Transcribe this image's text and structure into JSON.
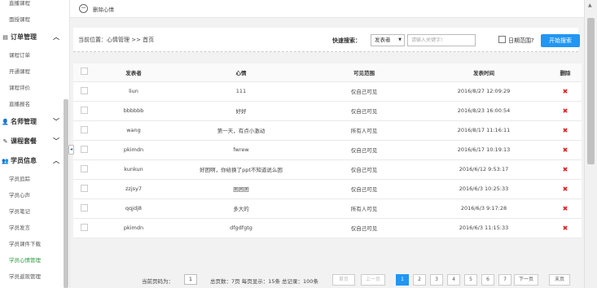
{
  "sidebar": {
    "items_top": [
      "直播课程",
      "面授课程"
    ],
    "order_group": {
      "label": "订单管理",
      "items": [
        "课程订单",
        "开通课程",
        "课程评价",
        "直播报名"
      ]
    },
    "teacher_group": {
      "label": "名师管理"
    },
    "course_group": {
      "label": "课程套餐"
    },
    "student_group": {
      "label": "学员信息",
      "items": [
        "学员追踪",
        "学员心声",
        "学员笔记",
        "学员发言",
        "学员课件下载",
        "学员心情管理",
        "学员返现管理"
      ]
    },
    "active_item": "学员心情管理"
  },
  "tab": {
    "label": "删除心情"
  },
  "toolbar": {
    "breadcrumb": "当前位置：心情管理 >> 首页",
    "quick_search_label": "快速搜索：",
    "select_value": "发表者",
    "input_placeholder": "请输入关键字!",
    "date_range_label": "日期范围?",
    "search_button": "开始搜索"
  },
  "table": {
    "headers": [
      "发表者",
      "心情",
      "可见范围",
      "发表时间",
      "删除"
    ],
    "rows": [
      {
        "author": "liun",
        "mood": "111",
        "scope": "仅自己可见",
        "time": "2016/8/27 12:09:29"
      },
      {
        "author": "bbbbbb",
        "mood": "好好",
        "scope": "仅自己可见",
        "time": "2016/8/23 16:00:54"
      },
      {
        "author": "wang",
        "mood": "第一天，有点小激动",
        "scope": "所有人可见",
        "time": "2016/8/17 11:16:11"
      },
      {
        "author": "pkimdn",
        "mood": "fwrew",
        "scope": "仅自己可见",
        "time": "2016/6/17 10:19:13"
      },
      {
        "author": "kunkun",
        "mood": "好困啊，你给换了ppt不知道说么困",
        "scope": "仅自己可见",
        "time": "2016/6/12 9:53:17"
      },
      {
        "author": "zzjsy7",
        "mood": "困困困",
        "scope": "仅自己可见",
        "time": "2016/6/3 10:25:33"
      },
      {
        "author": "qqjdj8",
        "mood": "多大的",
        "scope": "所有人可见",
        "time": "2016/6/3 9:17:28"
      },
      {
        "author": "pkimdn",
        "mood": "dfgdfgtg",
        "scope": "仅自己可见",
        "time": "2016/6/3 11:15:33"
      }
    ]
  },
  "pager": {
    "current_label": "当前页码为：",
    "current_page": "1",
    "summary": "总页数：7页 每页显示：15条 总记录：100条",
    "first": "首页",
    "prev": "上一页",
    "pages": [
      "1",
      "2",
      "3",
      "4",
      "5",
      "6",
      "7"
    ],
    "next": "下一页",
    "last": "末页"
  },
  "colors": {
    "accent": "#2196f3",
    "active_nav": "#2c9a3f",
    "delete": "#e02020"
  }
}
